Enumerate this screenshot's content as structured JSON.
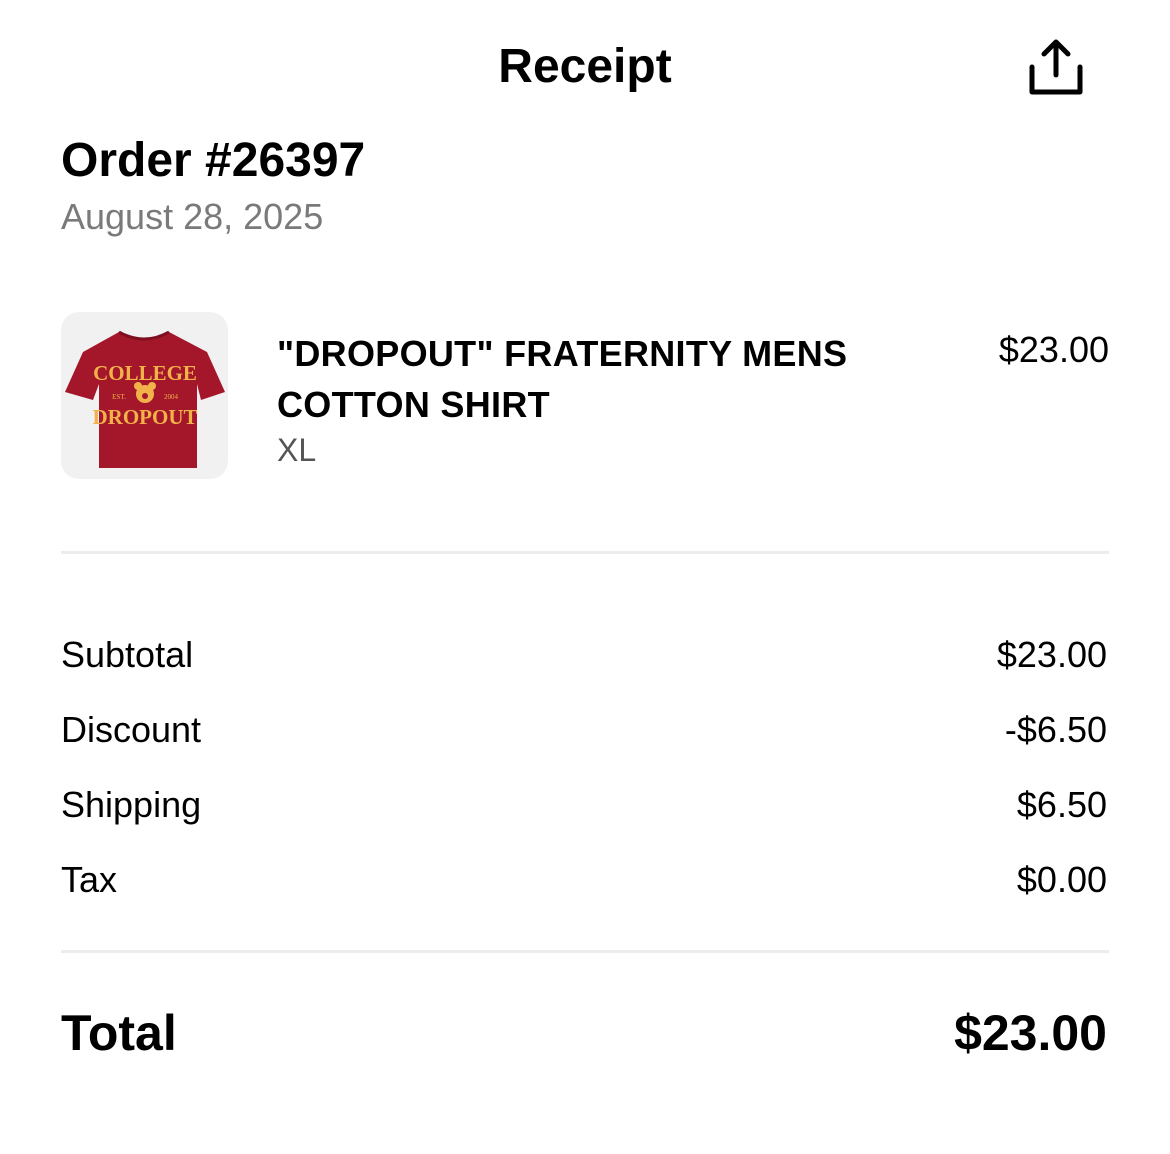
{
  "header": {
    "title": "Receipt",
    "share_icon": "share-icon"
  },
  "order": {
    "title": "Order #26397",
    "date": "August 28, 2025"
  },
  "items": [
    {
      "name": "\"DROPOUT\" FRATERNITY MENS COTTON SHIRT",
      "variant": "XL",
      "price": "$23.00",
      "image": {
        "shirt_color": "#a4162a",
        "print_color": "#f2b24a",
        "print_top": "COLLEGE",
        "print_est": "EST.",
        "print_year": "2004",
        "print_bottom": "DROPOUT"
      }
    }
  ],
  "summary": {
    "subtotal_label": "Subtotal",
    "subtotal_value": "$23.00",
    "discount_label": "Discount",
    "discount_value": "-$6.50",
    "shipping_label": "Shipping",
    "shipping_value": "$6.50",
    "tax_label": "Tax",
    "tax_value": "$0.00"
  },
  "total": {
    "label": "Total",
    "value": "$23.00"
  }
}
